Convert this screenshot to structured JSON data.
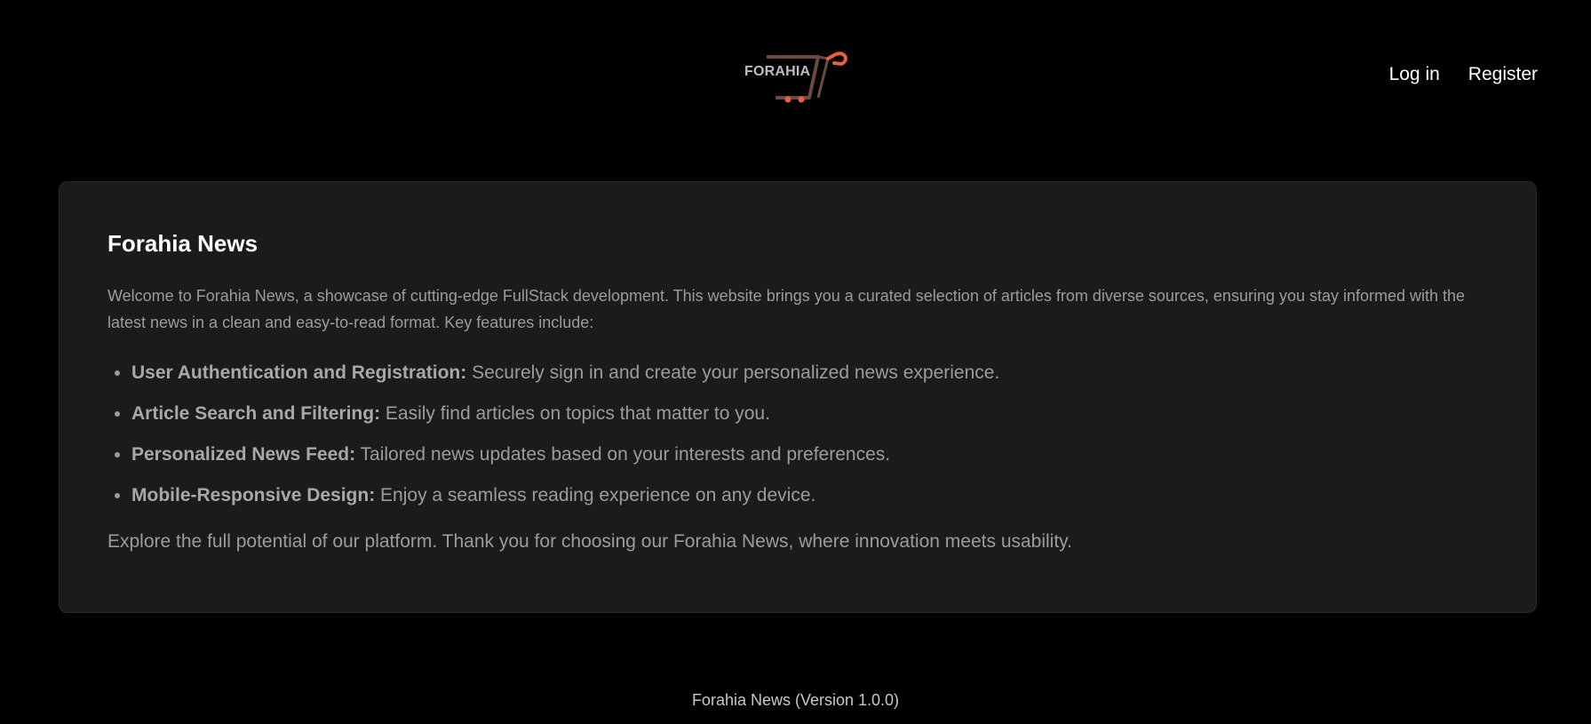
{
  "header": {
    "logo_text": "FORAHIA",
    "nav": {
      "login_label": "Log in",
      "register_label": "Register"
    }
  },
  "main": {
    "title": "Forahia News",
    "intro": "Welcome to Forahia News, a showcase of cutting-edge FullStack development. This website brings you a curated selection of articles from diverse sources, ensuring you stay informed with the latest news in a clean and easy-to-read format. Key features include:",
    "features": [
      {
        "title": "User Authentication and Registration:",
        "text": " Securely sign in and create your personalized news experience."
      },
      {
        "title": "Article Search and Filtering:",
        "text": " Easily find articles on topics that matter to you."
      },
      {
        "title": "Personalized News Feed:",
        "text": " Tailored news updates based on your interests and preferences."
      },
      {
        "title": "Mobile-Responsive Design:",
        "text": " Enjoy a seamless reading experience on any device."
      }
    ],
    "closing": "Explore the full potential of our platform. Thank you for choosing our Forahia News, where innovation meets usability."
  },
  "footer": {
    "text": "Forahia News (Version 1.0.0)"
  },
  "colors": {
    "background": "#000000",
    "card": "#1b1b1d",
    "logo_accent": "#e8613f",
    "logo_cart": "#6b4a3f"
  },
  "icons": {
    "logo": "shopping-cart-logo"
  }
}
